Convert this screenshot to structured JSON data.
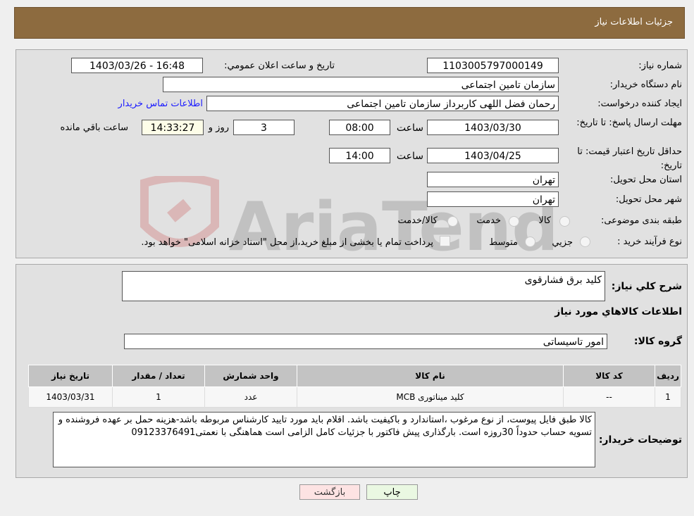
{
  "header": {
    "title": "جزئیات اطلاعات نیاز"
  },
  "form": {
    "need_number_label": "شماره نیاز:",
    "need_number": "1103005797000149",
    "announce_label": "تاریخ و ساعت اعلان عمومي:",
    "announce_value": "1403/03/26 - 16:48",
    "buyer_org_label": "نام دستگاه خریدار:",
    "buyer_org": "سازمان تامین اجتماعی",
    "creator_label": "ایجاد کننده درخواست:",
    "creator": "رحمان فضل اللهی کاربرداز سازمان تامین اجتماعی",
    "contact_link": "اطلاعات تماس خریدار",
    "deadline_label": "مهلت ارسال پاسخ: تا تاریخ:",
    "deadline_date": "1403/03/30",
    "time_label": "ساعت",
    "deadline_time": "08:00",
    "days": "3",
    "days_label": "روز و",
    "remaining": "14:33:27",
    "remaining_label": "ساعت باقي مانده",
    "validity_label": "حداقل تاریخ اعتبار قیمت: تا تاریخ:",
    "validity_date": "1403/04/25",
    "validity_time": "14:00",
    "province_label": "استان محل تحویل:",
    "province": "تهران",
    "city_label": "شهر محل تحویل:",
    "city": "تهران",
    "category_label": "طبقه بندی موضوعی:",
    "category_options": [
      "کالا",
      "خدمت",
      "کالا/خدمت"
    ],
    "process_label": "نوع فرآیند خرید :",
    "process_options": [
      "جزيي",
      "متوسط"
    ],
    "payment_note": "پرداخت تمام یا بخشی از مبلغ خرید،از محل \"اسناد خزانه اسلامی\" خواهد بود."
  },
  "watermark": "AriaTender.neT",
  "details": {
    "summary_label": "شرح کلي نیاز:",
    "summary": "کلید برق فشارقوی",
    "goods_info_title": "اطلاعات کالاهاي مورد نیاز",
    "group_label": "گروه کالا:",
    "group": "امور تاسیساتی",
    "table": {
      "headers": [
        "ردیف",
        "کد کالا",
        "نام کالا",
        "واحد شمارش",
        "تعداد / مقدار",
        "تاریخ نیاز"
      ],
      "rows": [
        [
          "1",
          "--",
          "کلید میناتوری MCB",
          "عدد",
          "1",
          "1403/03/31"
        ]
      ]
    },
    "buyer_notes_label": "توضیحات خریدار:",
    "buyer_notes": "کالا طبق فایل پیوست، از نوع مرغوب ،استاندارد و باکیفیت باشد. اقلام باید مورد تایید کارشناس مربوطه باشد-هزینه حمل بر عهده فروشنده و تسویه حساب حدوداً 30روزه است. بارگذاری پیش فاکتور با جزئیات کامل الزامی است هماهنگی با نعمتی09123376491"
  },
  "buttons": {
    "print": "چاپ",
    "back": "بازگشت"
  }
}
